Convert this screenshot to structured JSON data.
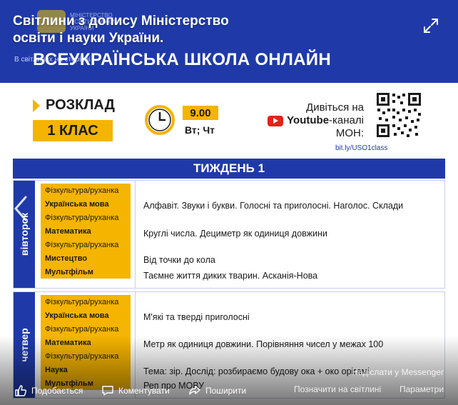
{
  "caption": {
    "title": "Світлини з допису Міністерство освіти і науки України.",
    "subtitle": "В світлинах на сторінці"
  },
  "banner": {
    "logo_text": "МІНІСТЕРСТВО ОСВІТИ І НАУКИ УКРАЇНИ",
    "headline": "ВСЕУКРАЇНСЬКА ШКОЛА ОНЛАЙН"
  },
  "info": {
    "schedule_label": "РОЗКЛАД",
    "grade": "1 КЛАС",
    "time": "9.00",
    "days": "Вт; Чт",
    "youtube_line1": "Дивіться на",
    "youtube_word": "Youtube",
    "youtube_line2_suffix": "-каналі",
    "youtube_line3": "МОН:",
    "link": "bit.ly/USO1class"
  },
  "week_title": "ТИЖДЕНЬ 1",
  "days": [
    {
      "name": "вівторок",
      "subjects": [
        {
          "label": "Фізкультура/руханка",
          "bold": false
        },
        {
          "label": "Українська мова",
          "bold": true
        },
        {
          "label": "Фізкультура/руханка",
          "bold": false
        },
        {
          "label": "Математика",
          "bold": true
        },
        {
          "label": "Фізкультура/руханка",
          "bold": false
        },
        {
          "label": "Мистецтво",
          "bold": true
        },
        {
          "label": "Мультфільм",
          "bold": true
        }
      ],
      "topics": [
        "Алфавіт. Звуки і букви. Голосні та приголосні. Наголос. Склади",
        "Круглі числа. Дециметр як одиниця довжини",
        "Від точки до кола",
        "Таємне життя диких тварин. Асканія-Нова"
      ]
    },
    {
      "name": "четвер",
      "subjects": [
        {
          "label": "Фізкультура/руханка",
          "bold": false
        },
        {
          "label": "Українська мова",
          "bold": true
        },
        {
          "label": "Фізкультура/руханка",
          "bold": false
        },
        {
          "label": "Математика",
          "bold": true
        },
        {
          "label": "Фізкультура/руханка",
          "bold": false
        },
        {
          "label": "Наука",
          "bold": true
        },
        {
          "label": "Мультфільм",
          "bold": true
        }
      ],
      "topics": [
        "М'які та тверді приголосні",
        "Метр як одиниця довжини. Порівняння чисел у межах 100",
        "Тема: зір. Дослід: розбираємо будову ока + око орігамі",
        "Реп про МОВУ"
      ]
    }
  ],
  "actions": {
    "like": "Подобається",
    "comment": "Коментувати",
    "share": "Поширити",
    "tag": "Позначити на світлині",
    "options": "Параметри",
    "send": "Надіслати у Messenger"
  },
  "colors": {
    "brand_blue": "#1f3aa8",
    "accent_yellow": "#f5b400"
  }
}
